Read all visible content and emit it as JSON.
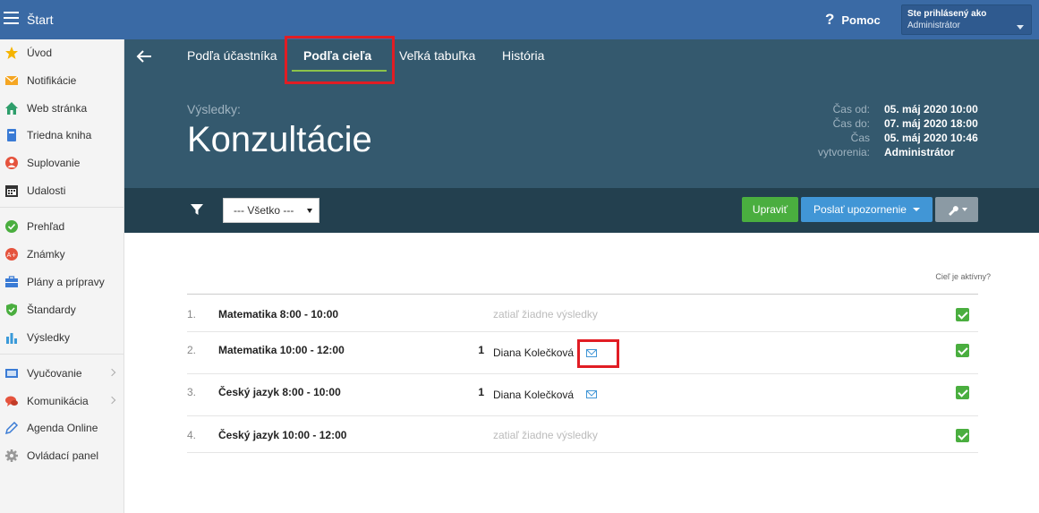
{
  "topbar": {
    "title": "Štart",
    "help_label": "Pomoc",
    "user_line1": "Ste prihlásený ako",
    "user_line2": "Administrátor"
  },
  "sidebar": {
    "items": [
      {
        "label": "Úvod",
        "icon": "star-icon",
        "color": "#f5b400"
      },
      {
        "label": "Notifikácie",
        "icon": "envelope-icon",
        "color": "#f5a623"
      },
      {
        "label": "Web stránka",
        "icon": "home-icon",
        "color": "#2e9e6b"
      },
      {
        "label": "Triedna kniha",
        "icon": "book-icon",
        "color": "#3a7bd5"
      },
      {
        "label": "Suplovanie",
        "icon": "person-icon",
        "color": "#e5533d"
      },
      {
        "label": "Udalosti",
        "icon": "calendar-icon",
        "color": "#333333"
      },
      {
        "label": "Prehľad",
        "icon": "check-circle-icon",
        "color": "#4aae3f"
      },
      {
        "label": "Známky",
        "icon": "grade-icon",
        "color": "#e5533d"
      },
      {
        "label": "Plány a prípravy",
        "icon": "briefcase-icon",
        "color": "#3a7bd5"
      },
      {
        "label": "Štandardy",
        "icon": "shield-check-icon",
        "color": "#4aae3f"
      },
      {
        "label": "Výsledky",
        "icon": "bar-chart-icon",
        "color": "#3a9ad9"
      },
      {
        "label": "Vyučovanie",
        "icon": "board-icon",
        "color": "#3a7bd5"
      },
      {
        "label": "Komunikácia",
        "icon": "chat-icon",
        "color": "#e5533d"
      },
      {
        "label": "Agenda Online",
        "icon": "pencil-icon",
        "color": "#3a7bd5"
      },
      {
        "label": "Ovládací panel",
        "icon": "gear-icon",
        "color": "#999999"
      }
    ]
  },
  "header": {
    "tabs": [
      {
        "label": "Podľa účastníka"
      },
      {
        "label": "Podľa cieľa"
      },
      {
        "label": "Veľká tabuľka"
      },
      {
        "label": "História"
      }
    ],
    "results_label": "Výsledky:",
    "title": "Konzultácie",
    "meta_labels": [
      "Čas od:",
      "Čas do:",
      "Čas",
      "vytvorenia:"
    ],
    "meta_values": [
      "05. máj 2020 10:00",
      "07. máj 2020 18:00",
      "05. máj 2020 10:46",
      "Administrátor"
    ]
  },
  "toolbar": {
    "filter_value": "--- Všetko ---",
    "edit_label": "Upraviť",
    "notify_label": "Poslať upozornenie"
  },
  "table": {
    "active_header": "Cieľ je aktívny?",
    "rows": [
      {
        "num": "1.",
        "name": "Matematika 8:00 - 10:00",
        "count": "",
        "person": "",
        "empty": "zatiaľ žiadne výsledky"
      },
      {
        "num": "2.",
        "name": "Matematika 10:00 - 12:00",
        "count": "1",
        "person": "Diana Kolečková",
        "empty": ""
      },
      {
        "num": "3.",
        "name": "Český jazyk 8:00 - 10:00",
        "count": "1",
        "person": "Diana Kolečková",
        "empty": ""
      },
      {
        "num": "4.",
        "name": "Český jazyk 10:00 - 12:00",
        "count": "",
        "person": "",
        "empty": "zatiaľ žiadne výsledky"
      }
    ]
  },
  "colors": {
    "topbar": "#3a6aa5",
    "header": "#34596e",
    "toolbar": "#23404f",
    "highlight": "#e11d24",
    "green": "#4aae3f",
    "blue": "#4196d6"
  }
}
